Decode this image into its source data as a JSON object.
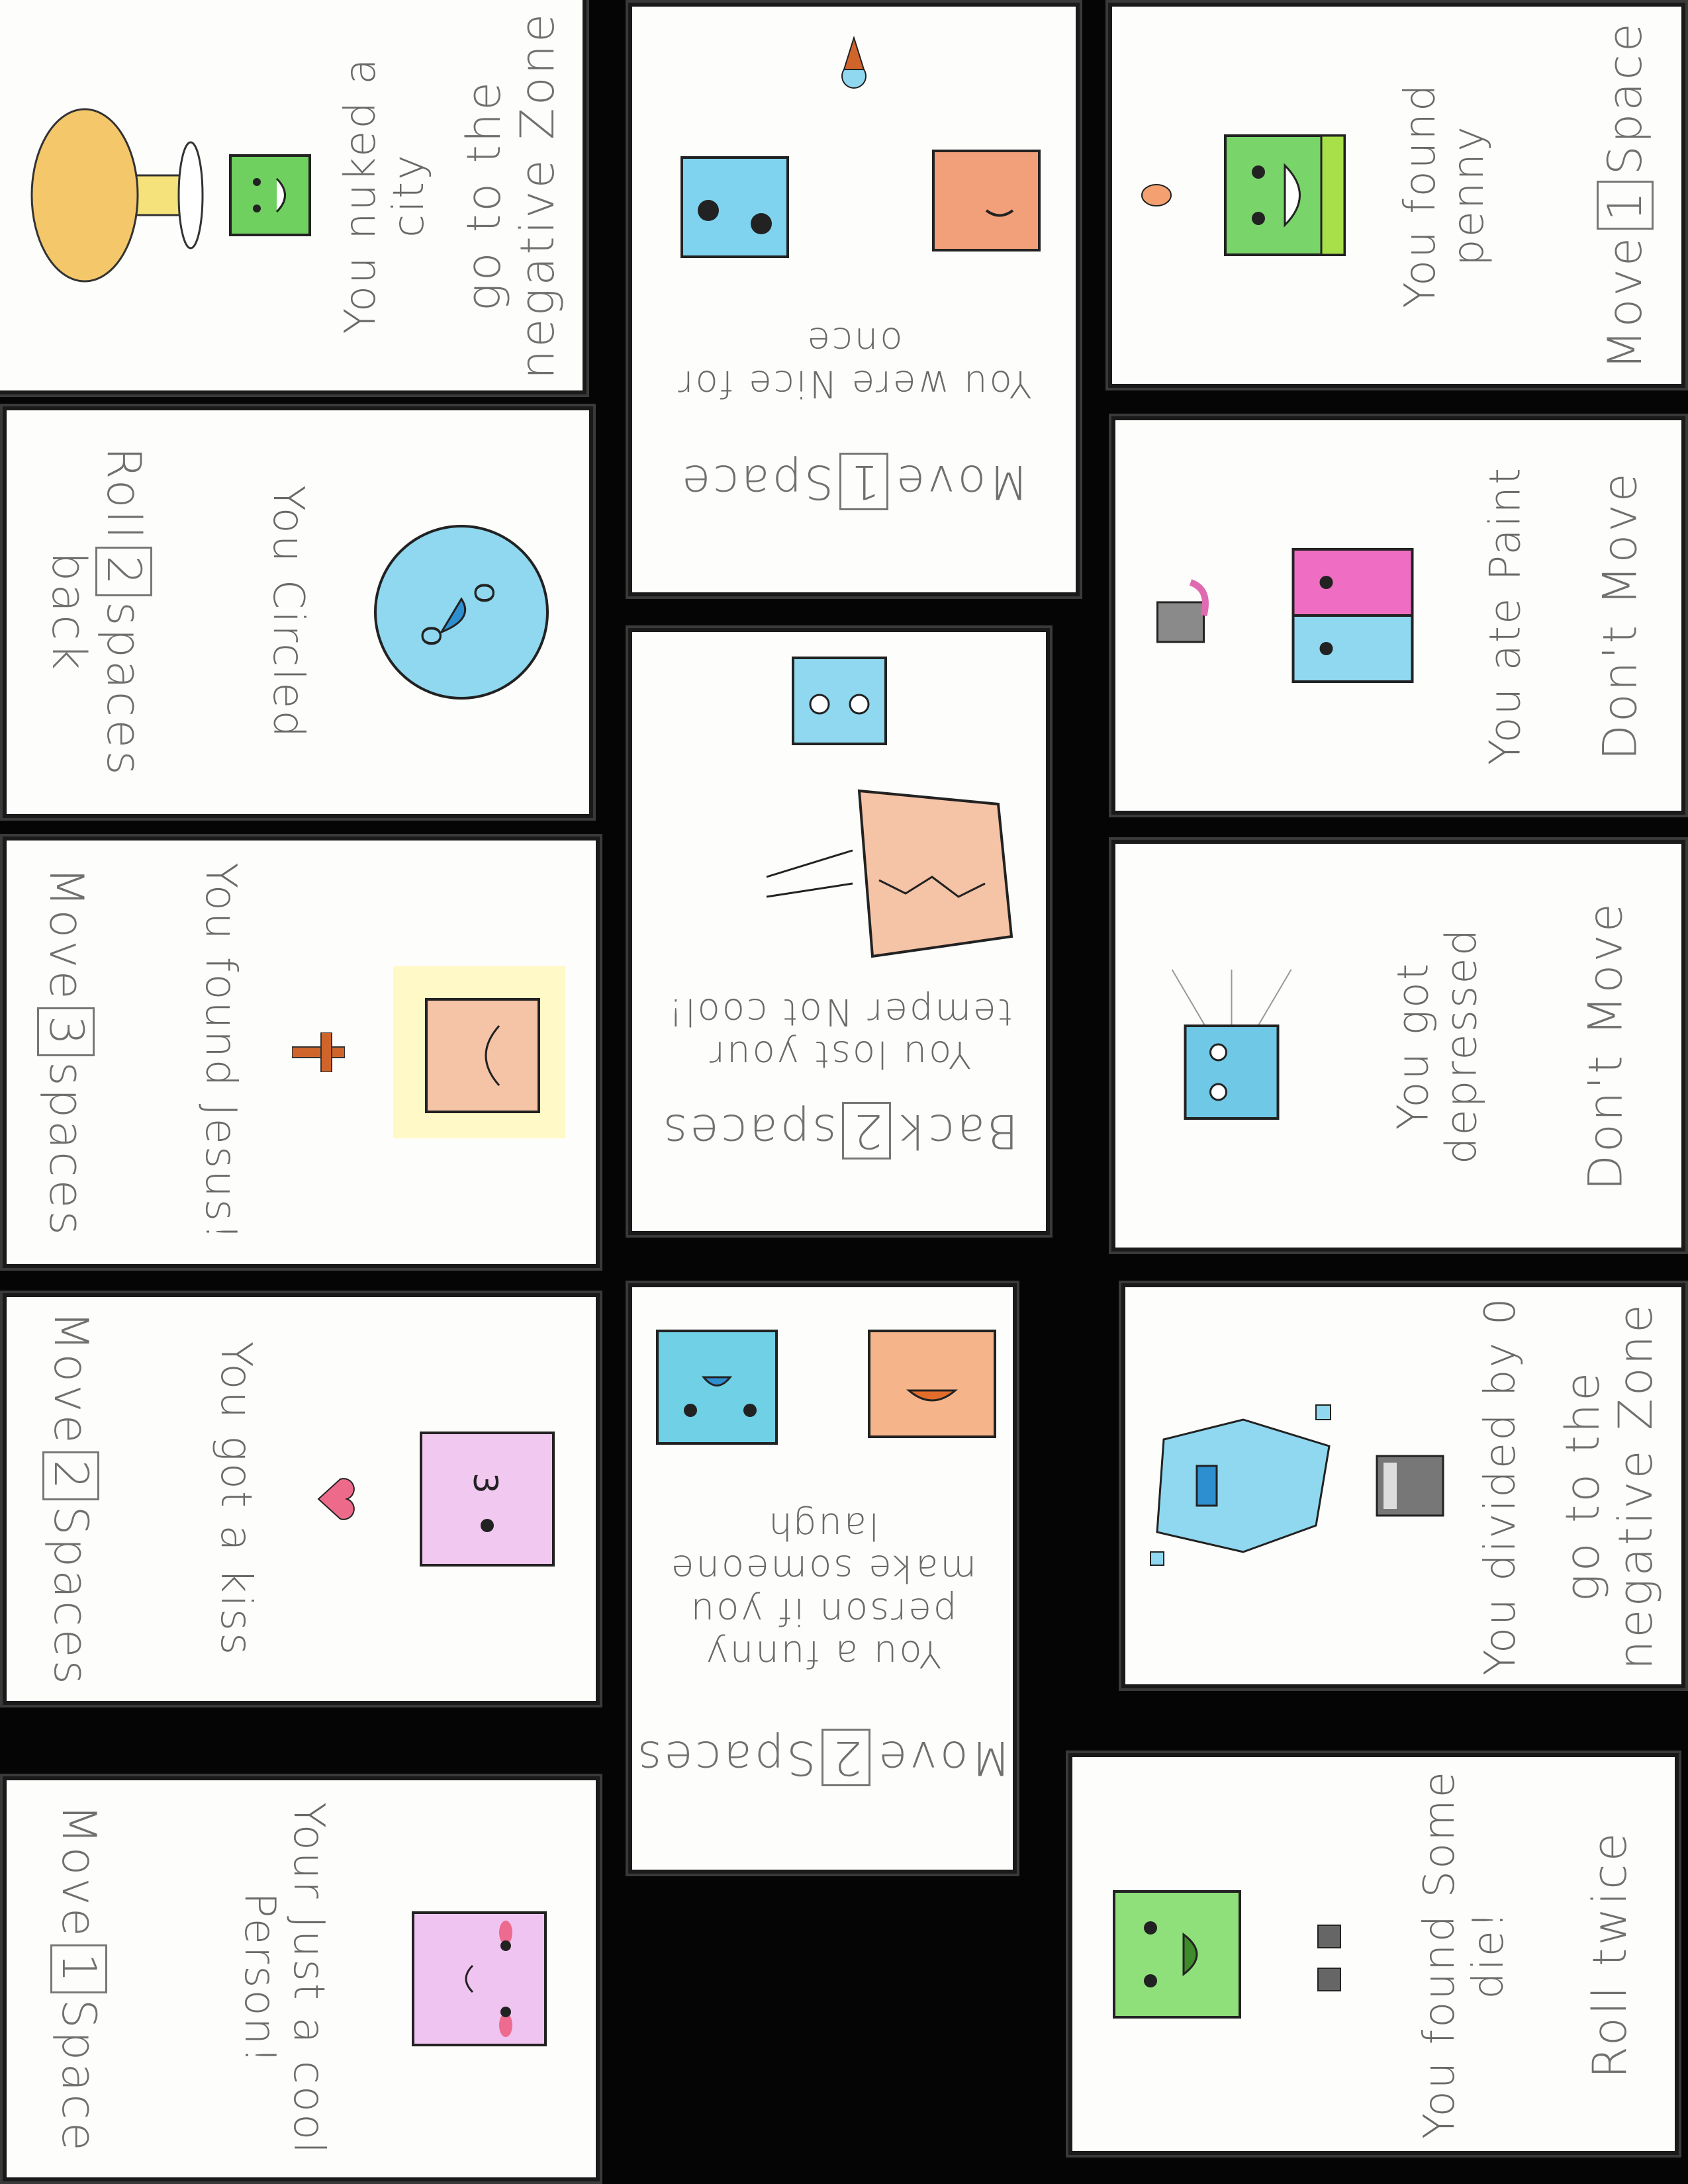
{
  "cards": [
    {
      "id": "nuked",
      "text": "You nuked a city",
      "action_pre": "go to the negative Zone",
      "icon": "mushroom-cloud-icon",
      "face": "green-face-icon"
    },
    {
      "id": "nice",
      "text": "You were Nice for once",
      "action_pre": "Move",
      "num": "1",
      "action_post": "Space",
      "icon": "ice-cream-icon",
      "face": "blue-orange-faces-icon"
    },
    {
      "id": "penny",
      "text": "You found penny",
      "action_pre": "Move",
      "num": "1",
      "action_post": "Space",
      "icon": "penny-icon",
      "face": "green-smile-face-icon"
    },
    {
      "id": "circled",
      "text": "You Circled",
      "action_pre": "Roll",
      "num": "2",
      "action_post": "spaces back",
      "icon": "blue-circle-face-icon",
      "face": ""
    },
    {
      "id": "temper",
      "text": "You lost your temper Not cool!",
      "action_pre": "Back",
      "num": "2",
      "action_post": "spaces",
      "icon": "angry-paper-icon",
      "face": "scared-blue-face-icon"
    },
    {
      "id": "paint",
      "text": "You ate Paint",
      "action_pre": "Don't Move",
      "icon": "paint-bucket-icon",
      "face": "pink-blue-face-icon"
    },
    {
      "id": "jesus",
      "text": "You found Jesus!",
      "action_pre": "Move",
      "num": "3",
      "action_post": "spaces",
      "icon": "cross-icon",
      "face": "peach-face-icon"
    },
    {
      "id": "depressed",
      "text": "You got depressed",
      "action_pre": "Don't Move",
      "icon": "rain-cloud-icon",
      "face": "sad-blue-face-icon"
    },
    {
      "id": "kiss",
      "text": "You got a kiss",
      "action_pre": "Move",
      "num": "2",
      "action_post": "Spaces",
      "icon": "heart-icon",
      "face": "pink-kiss-face-icon"
    },
    {
      "id": "funny",
      "text": "You a funny person if you make someone laugh",
      "action_pre": "Move",
      "num": "2",
      "action_post": "Spaces",
      "icon": "laughing-faces-icon",
      "face": ""
    },
    {
      "id": "divided",
      "text": "You divided by 0",
      "action_pre": "go to the negative Zone",
      "icon": "calculator-icon",
      "face": "shattered-blue-face-icon"
    },
    {
      "id": "cool",
      "text": "Your Just a cool Person!",
      "action_pre": "Move",
      "num": "1",
      "action_post": "Space",
      "icon": "",
      "face": "pink-blush-face-icon"
    },
    {
      "id": "dice",
      "text": "You found Some die!",
      "action_pre": "Roll twice",
      "icon": "dice-icon",
      "face": "green-face-icon"
    }
  ]
}
